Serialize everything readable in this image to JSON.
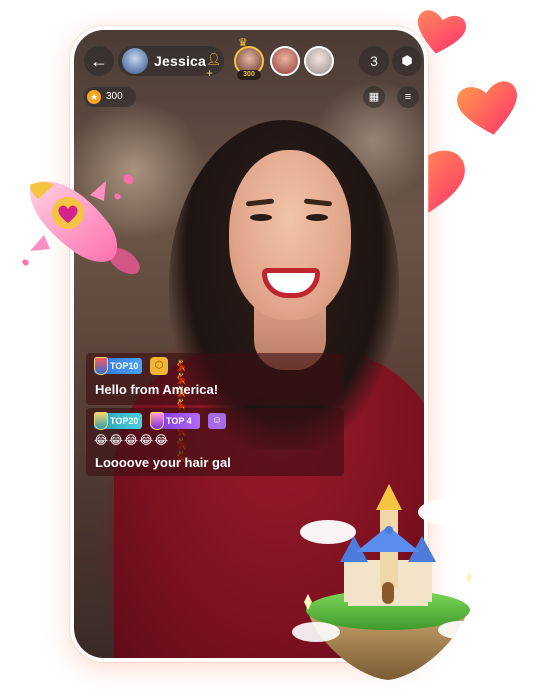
{
  "header": {
    "host_name": "Jessica",
    "top_viewer_score": "300",
    "viewer_count": "3"
  },
  "wallet": {
    "coins": "300"
  },
  "chat": [
    {
      "badges": [
        "TOP10"
      ],
      "fans_glyphs": "💃💃💃💃💃💃💃💃",
      "text": "Hello from America!"
    },
    {
      "badges": [
        "TOP20",
        "TOP 4"
      ],
      "emojis": "😂😂😂😂😂",
      "text": "Loooove your hair gal"
    }
  ],
  "colors": {
    "heart": "#ff4d7a",
    "sweater": "#7c1120",
    "coin": "#f5a623",
    "badge_top10": "#2f6fd6",
    "badge_top20": "#2a9bb0",
    "badge_top4": "#7a2fd6"
  },
  "icons": {
    "back": "arrow-left-icon",
    "follow": "add-friend-icon",
    "settings": "hexagon-settings-icon",
    "calendar": "calendar-icon",
    "menu": "menu-icon",
    "coin": "star-coin-icon"
  }
}
